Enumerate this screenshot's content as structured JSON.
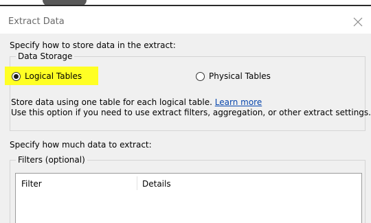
{
  "dialog": {
    "title": "Extract Data",
    "close_icon": "close-icon"
  },
  "store": {
    "label": "Specify how to store data in the extract:",
    "group_label": "Data Storage",
    "options": [
      {
        "label": "Logical Tables",
        "selected": true
      },
      {
        "label": "Physical Tables",
        "selected": false
      }
    ],
    "description_line1": "Store data using one table for each logical table.",
    "learn_more": "Learn more",
    "description_line2": "Use this option if you need to use extract filters, aggregation, or other extract settings.",
    "highlight_color": "#ffff24"
  },
  "amount": {
    "label": "Specify how much data to extract:",
    "filters_group_label": "Filters (optional)",
    "columns": [
      "Filter",
      "Details"
    ],
    "rows": []
  }
}
